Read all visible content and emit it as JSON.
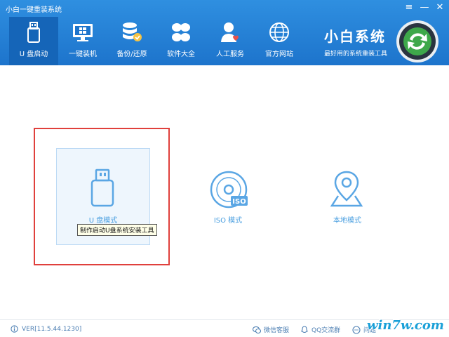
{
  "window": {
    "title": "小白一键重装系统"
  },
  "nav": {
    "items": [
      {
        "label": "U 盘启动",
        "icon": "usb-drive-icon",
        "active": true
      },
      {
        "label": "一键装机",
        "icon": "monitor-windows-icon",
        "active": false
      },
      {
        "label": "备份/还原",
        "icon": "database-backup-icon",
        "active": false
      },
      {
        "label": "软件大全",
        "icon": "apps-icon",
        "active": false
      },
      {
        "label": "人工服务",
        "icon": "support-agent-icon",
        "active": false
      },
      {
        "label": "官方网站",
        "icon": "globe-icon",
        "active": false
      }
    ]
  },
  "brand": {
    "name": "小白系统",
    "slogan": "最好用的系统重装工具"
  },
  "modes": {
    "usb": {
      "label": "U 盘模式",
      "tooltip": "制作启动U盘系统安装工具"
    },
    "iso": {
      "label": "ISO 模式",
      "badge": "ISO"
    },
    "local": {
      "label": "本地模式"
    }
  },
  "footer": {
    "version": "VER[11.5.44.1230]",
    "wechat": "微信客服",
    "qq": "QQ交流群",
    "faq": "问题"
  },
  "watermark": "win7w.com",
  "colors": {
    "header": "#1d74cc",
    "accent": "#4a9fe0",
    "highlight": "#e0403c"
  }
}
